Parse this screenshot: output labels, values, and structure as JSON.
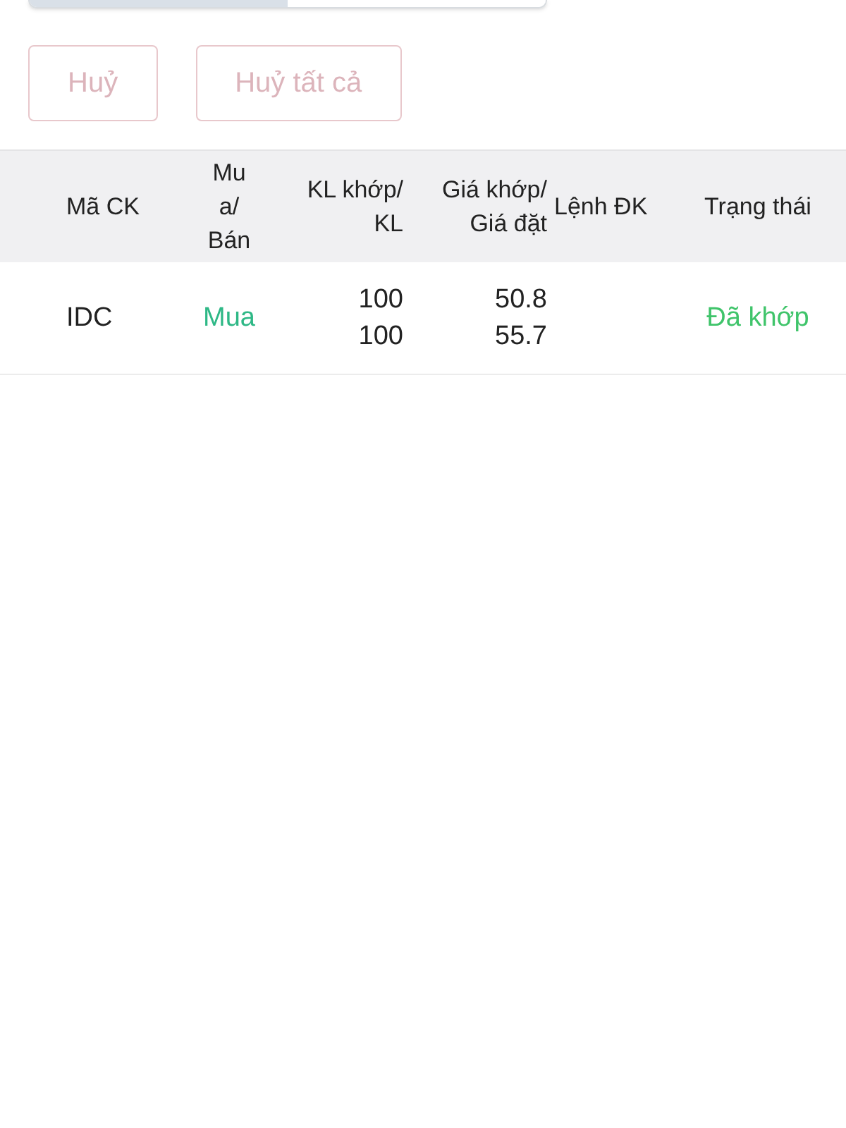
{
  "segmented_control": {
    "segments": [
      {
        "selected": true
      },
      {
        "selected": false
      }
    ]
  },
  "buttons": [
    {
      "label": "Huỷ",
      "disabled": true
    },
    {
      "label": "Huỷ tất cả",
      "disabled": true
    }
  ],
  "table": {
    "columns": [
      "Mã CK",
      "Mu\na/\nBán",
      "KL khớp/\nKL",
      "Giá khớp/\nGiá đặt",
      "Lệnh ĐK",
      "Trạng thái"
    ],
    "rows": [
      {
        "symbol": "IDC",
        "side": {
          "text": "Mua",
          "kind": "buy"
        },
        "matched_qty": "100",
        "qty": "100",
        "matched_price": "50.8",
        "order_price": "55.7",
        "status": {
          "text": "Đã khớp",
          "kind": "matched"
        }
      }
    ]
  }
}
